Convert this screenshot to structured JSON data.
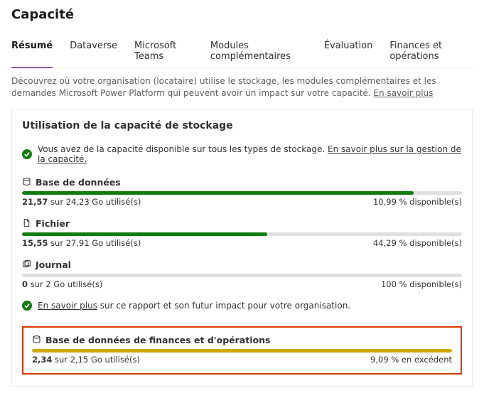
{
  "page": {
    "title": "Capacité",
    "intro_text": "Découvrez où votre organisation (locataire) utilise le stockage, les modules complémentaires et les demandes Microsoft Power Platform qui peuvent avoir un impact sur votre capacité. ",
    "intro_link": "En savoir plus"
  },
  "tabs": [
    {
      "id": "resume",
      "label": "Résumé",
      "active": true
    },
    {
      "id": "dataverse",
      "label": "Dataverse",
      "active": false
    },
    {
      "id": "teams",
      "label": "Microsoft Teams",
      "active": false
    },
    {
      "id": "addons",
      "label": "Modules complémentaires",
      "active": false
    },
    {
      "id": "eval",
      "label": "Évaluation",
      "active": false
    },
    {
      "id": "finops",
      "label": "Finances et opérations",
      "active": false
    }
  ],
  "card": {
    "title": "Utilisation de la capacité de stockage",
    "status_text": "Vous avez de la capacité disponible sur tous les types de stockage. ",
    "status_link": "En savoir plus sur la gestion de la capacité.",
    "info_link": "En savoir plus",
    "info_text_rest": " sur ce rapport et son futur impact pour votre organisation."
  },
  "metrics": {
    "database": {
      "label": "Base de données",
      "used_value": "21,57",
      "used_rest": " sur 24,23 Go utilisé(s)",
      "available": "10,99 % disponible(s)",
      "percent_width": "89%",
      "bar_class": "bar-green"
    },
    "file": {
      "label": "Fichier",
      "used_value": "15,55",
      "used_rest": " sur 27,91 Go utilisé(s)",
      "available": "44,29 % disponible(s)",
      "percent_width": "55.7%",
      "bar_class": "bar-green"
    },
    "journal": {
      "label": "Journal",
      "used_value": "0",
      "used_rest": " sur 2 Go utilisé(s)",
      "available": "100 % disponible(s)",
      "percent_width": "0%",
      "bar_class": "bar-grey"
    },
    "finops_db": {
      "label": "Base de données de finances et d'opérations",
      "used_value": "2,34",
      "used_rest": " sur 2,15 Go utilisé(s)",
      "available": "9,09 % en excédent",
      "percent_width": "100%",
      "bar_class": "bar-gold"
    }
  },
  "chart_data": [
    {
      "type": "bar",
      "title": "Base de données",
      "categories": [
        "Utilisé"
      ],
      "values": [
        21.57
      ],
      "ylim": [
        0,
        24.23
      ],
      "ylabel": "Go"
    },
    {
      "type": "bar",
      "title": "Fichier",
      "categories": [
        "Utilisé"
      ],
      "values": [
        15.55
      ],
      "ylim": [
        0,
        27.91
      ],
      "ylabel": "Go"
    },
    {
      "type": "bar",
      "title": "Journal",
      "categories": [
        "Utilisé"
      ],
      "values": [
        0
      ],
      "ylim": [
        0,
        2
      ],
      "ylabel": "Go"
    },
    {
      "type": "bar",
      "title": "Base de données de finances et d'opérations",
      "categories": [
        "Utilisé"
      ],
      "values": [
        2.34
      ],
      "ylim": [
        0,
        2.15
      ],
      "ylabel": "Go"
    }
  ]
}
